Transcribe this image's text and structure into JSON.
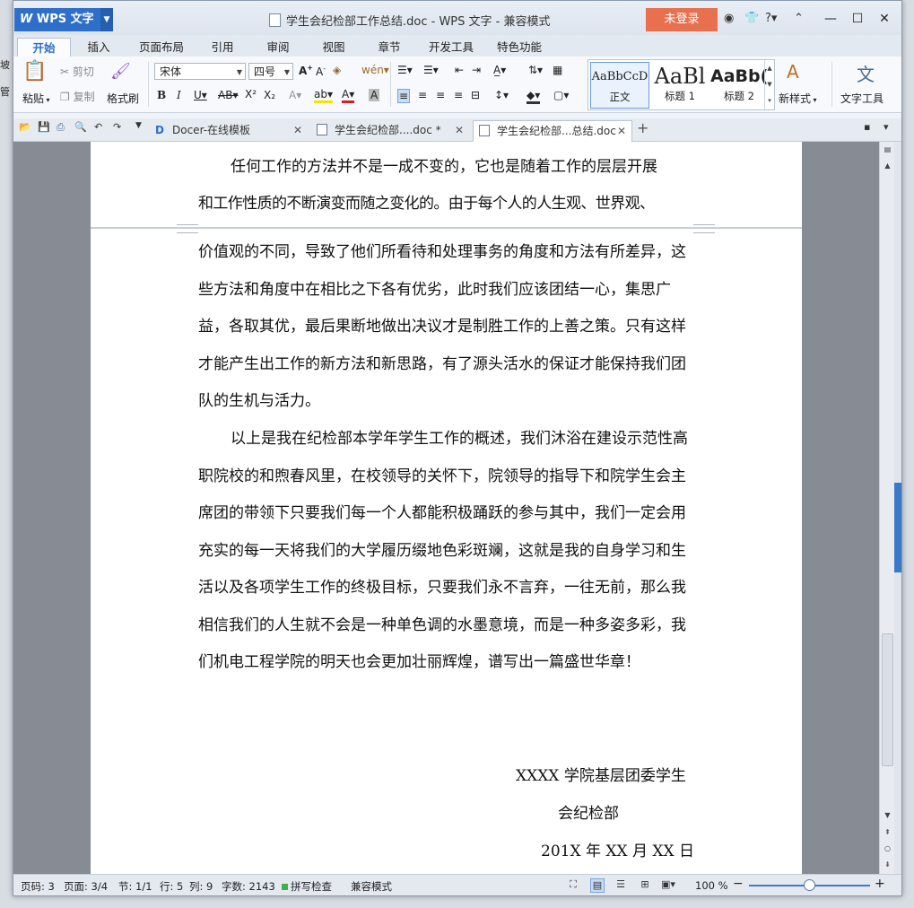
{
  "app": {
    "name": "WPS 文字",
    "window_title": "学生会纪检部工作总结.doc - WPS 文字 - 兼容模式",
    "login_label": "未登录"
  },
  "tabs": [
    {
      "label": "开始",
      "active": true
    },
    {
      "label": "插入"
    },
    {
      "label": "页面布局"
    },
    {
      "label": "引用"
    },
    {
      "label": "审阅"
    },
    {
      "label": "视图"
    },
    {
      "label": "章节"
    },
    {
      "label": "开发工具"
    },
    {
      "label": "特色功能"
    }
  ],
  "ribbon": {
    "paste": "粘贴",
    "cut": "剪切",
    "copy": "复制",
    "format_painter": "格式刷",
    "font_name": "宋体",
    "font_size": "四号",
    "styles": [
      {
        "sample": "AaBbCcD",
        "label": "正文",
        "selected": true
      },
      {
        "sample": "AaBl",
        "label": "标题 1"
      },
      {
        "sample": "AaBb(",
        "label": "标题 2"
      }
    ],
    "new_style": "新样式",
    "text_tools": "文字工具"
  },
  "doc_tabs": [
    {
      "label": "Docer-在线模板"
    },
    {
      "label": "学生会纪检部....doc *"
    },
    {
      "label": "学生会纪检部...总结.doc",
      "active": true
    }
  ],
  "document": {
    "top_lines": [
      "任何工作的方法并不是一成不变的，它也是随着工作的层层开展",
      "和工作性质的不断演变而随之变化的。由于每个人的人生观、世界观、"
    ],
    "para1": "价值观的不同，导致了他们所看待和处理事务的角度和方法有所差异，这些方法和角度中在相比之下各有优劣，此时我们应该团结一心，集思广益，各取其优，最后果断地做出决议才是制胜工作的上善之策。只有这样才能产生出工作的新方法和新思路，有了源头活水的保证才能保持我们团队的生机与活力。",
    "para2": "以上是我在纪检部本学年学生工作的概述，我们沐浴在建设示范性高职院校的和煦春风里，在校领导的关怀下，院领导的指导下和院学生会主席团的带领下只要我们每一个人都能积极踊跃的参与其中，我们一定会用充实的每一天将我们的大学履历缀地色彩斑斓，这就是我的自身学习和生活以及各项学生工作的终极目标，只要我们永不言弃，一往无前，那么我相信我们的人生就不会是一种单色调的水墨意境，而是一种多姿多彩，我们机电工程学院的明天也会更加壮丽辉煌，谱写出一篇盛世华章！",
    "signature_line1": "XXXX 学院基层团委学生",
    "signature_line2": "会纪检部",
    "date_line": "201X 年 XX 月 XX 日"
  },
  "status_bar": {
    "page_code": "页码: 3",
    "page": "页面: 3/4",
    "section": "节: 1/1",
    "line": "行: 5",
    "column": "列: 9",
    "word_count": "字数: 2143",
    "spell_check": "拼写检查",
    "compat_mode": "兼容模式",
    "zoom": "100 %",
    "zoom_level": 100
  },
  "colors": {
    "accent": "#2d6fc9",
    "login": "#e8704e",
    "page_bg": "#868b94"
  }
}
